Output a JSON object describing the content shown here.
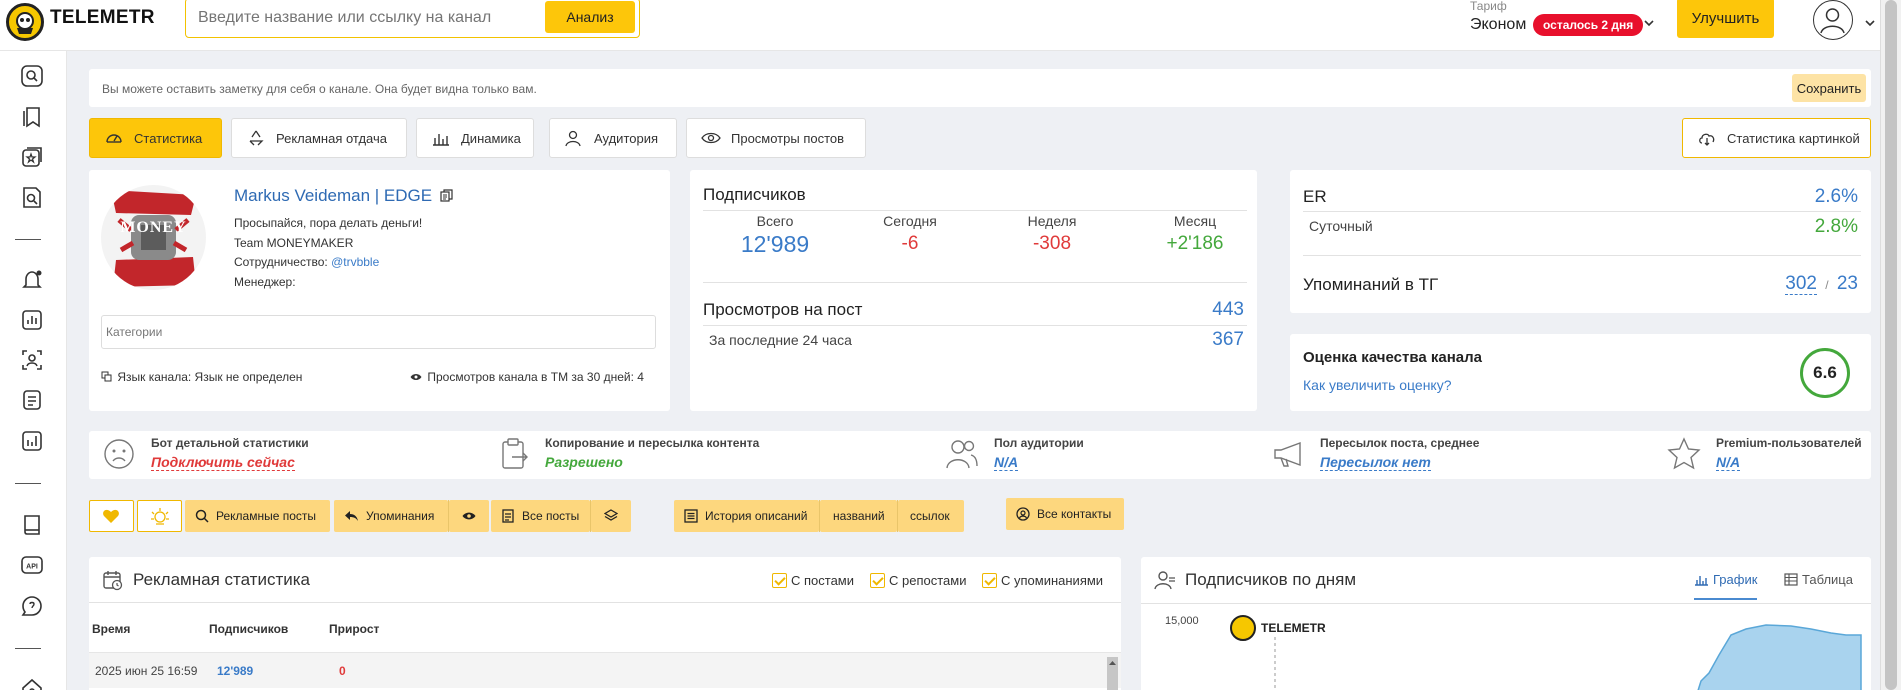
{
  "header": {
    "logo_text": "TELEMETR",
    "search_placeholder": "Введите название или ссылку на канал",
    "analyze_label": "Анализ",
    "tariff_label": "Тариф",
    "tariff_name": "Эконом",
    "tariff_badge": "осталось 2 дня",
    "upgrade_label": "Улучшить"
  },
  "note": {
    "placeholder": "Вы можете оставить заметку для себя о канале. Она будет видна только вам.",
    "save_label": "Сохранить"
  },
  "tabs": [
    {
      "label": "Статистика"
    },
    {
      "label": "Рекламная отдача"
    },
    {
      "label": "Динамика"
    },
    {
      "label": "Аудитория"
    },
    {
      "label": "Просмотры постов"
    }
  ],
  "stat_image_label": "Статистика картинкой",
  "channel": {
    "avatar_text": "MONEY MAKER",
    "name": "Markus Veideman | EDGE",
    "desc1": "Просыпайся, пора делать деньги!",
    "desc2": "Team MONEYMAKER",
    "coop_label": "Сотрудничество:",
    "coop_link": "@trvbble",
    "manager_label": "Менеджер:",
    "categories_placeholder": "Категории",
    "lang": "Язык канала: Язык не определен",
    "tm_views": "Просмотров канала в ТМ за 30 дней: 4"
  },
  "subscribers": {
    "title": "Подписчиков",
    "cols": [
      {
        "label": "Всего",
        "value": "12'989"
      },
      {
        "label": "Сегодня",
        "value": "-6"
      },
      {
        "label": "Неделя",
        "value": "-308"
      },
      {
        "label": "Месяц",
        "value": "+2'186"
      }
    ],
    "views_title": "Просмотров на пост",
    "views_value": "443",
    "views24_label": "За последние 24 часа",
    "views24_value": "367"
  },
  "er": {
    "title": "ER",
    "value": "2.6%",
    "daily_label": "Суточный",
    "daily_value": "2.8%",
    "mentions_label": "Упоминаний в ТГ",
    "mentions_a": "302",
    "mentions_sep": "/",
    "mentions_b": "23"
  },
  "quality": {
    "title": "Оценка качества канала",
    "link": "Как увеличить оценку?",
    "score": "6.6"
  },
  "info": [
    {
      "title": "Бот детальной статистики",
      "value": "Подключить сейчас"
    },
    {
      "title": "Копирование и пересылка контента",
      "value": "Разрешено"
    },
    {
      "title": "Пол аудитории",
      "value": "N/A"
    },
    {
      "title": "Пересылок поста, среднее",
      "value": "Пересылок нет"
    },
    {
      "title": "Premium-пользователей",
      "value": "N/A"
    }
  ],
  "toolbar": {
    "ad_posts": "Рекламные посты",
    "mentions": "Упоминания",
    "all_posts": "Все посты",
    "history": "История описаний",
    "names": "названий",
    "links": "ссылок",
    "contacts": "Все контакты"
  },
  "ad_stats": {
    "title": "Рекламная статистика",
    "cb1": "С постами",
    "cb2": "С репостами",
    "cb3": "С упоминаниями",
    "columns": [
      "Время",
      "Подписчиков",
      "Прирост"
    ],
    "rows": [
      {
        "time": "2025 июн 25 16:59",
        "subs": "12'989",
        "growth": "0"
      }
    ]
  },
  "subs_days": {
    "title": "Подписчиков по дням",
    "tab_chart": "График",
    "tab_table": "Таблица",
    "watermark": "TELEMETR",
    "y_tick": "15,000"
  },
  "chart_data": {
    "type": "area",
    "y_ticks": [
      "15,000"
    ],
    "title": ""
  }
}
